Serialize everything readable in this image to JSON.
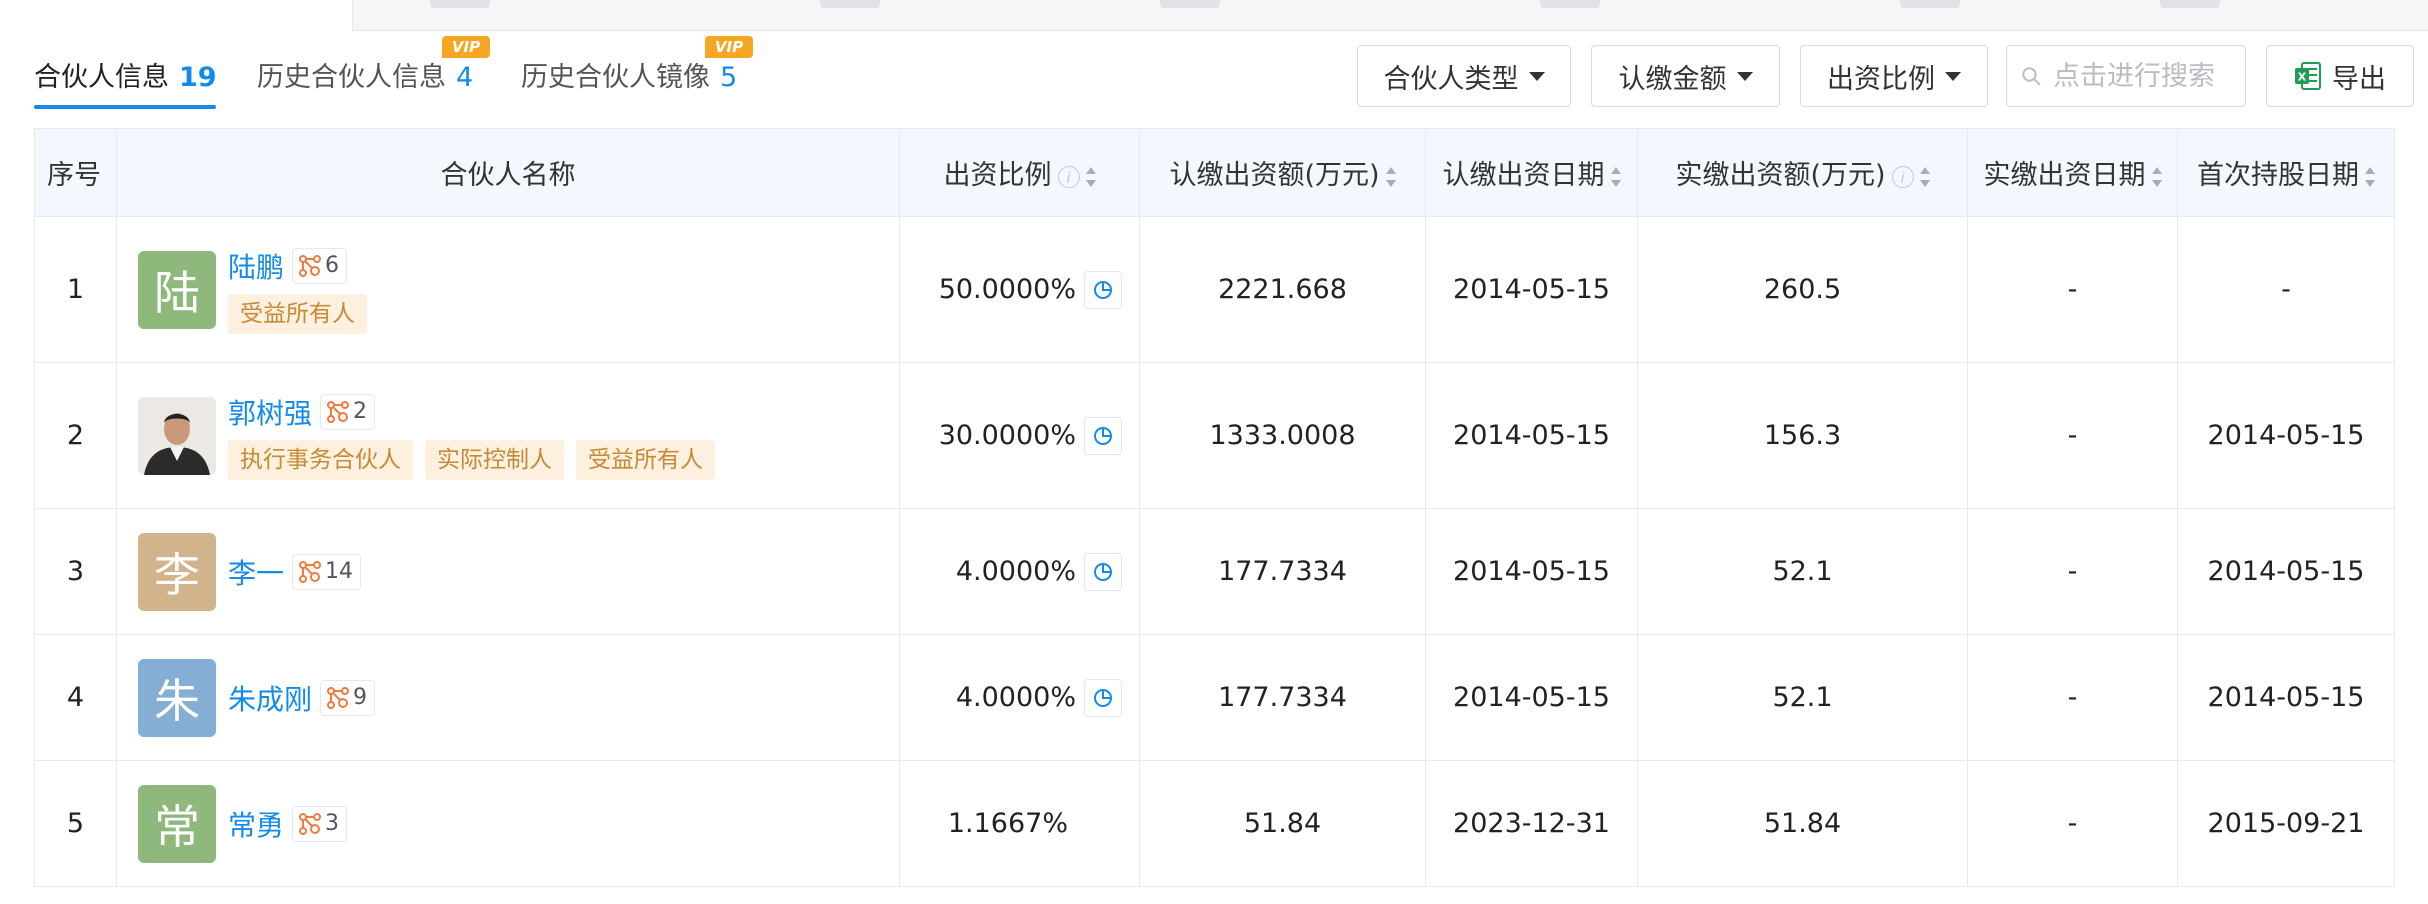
{
  "subtabs": [
    {
      "label": "合伙人信息",
      "count": "19",
      "vip": false
    },
    {
      "label": "历史合伙人信息",
      "count": "4",
      "vip": true
    },
    {
      "label": "历史合伙人镜像",
      "count": "5",
      "vip": true
    }
  ],
  "vip_badge": "VIP",
  "filters": {
    "type": "合伙人类型",
    "amount": "认缴金额",
    "ratio": "出资比例"
  },
  "search": {
    "placeholder": "点击进行搜索"
  },
  "export": {
    "label": "导出"
  },
  "columns": [
    "序号",
    "合伙人名称",
    "出资比例",
    "认缴出资额(万元)",
    "认缴出资日期",
    "实缴出资额(万元)",
    "实缴出资日期",
    "首次持股日期"
  ],
  "rows": [
    {
      "index": "1",
      "avatar_char": "陆",
      "avatar_color": "#8fb87d",
      "name": "陆鹏",
      "rel_count": "6",
      "tags": [
        "受益所有人"
      ],
      "ratio": "50.0000%",
      "sub_amount": "2221.668",
      "sub_date": "2014-05-15",
      "paid_amount": "260.5",
      "paid_date": "-",
      "first_date": "-"
    },
    {
      "index": "2",
      "avatar_char": "",
      "avatar_color": "#e8e8e8",
      "name": "郭树强",
      "rel_count": "2",
      "tags": [
        "执行事务合伙人",
        "实际控制人",
        "受益所有人"
      ],
      "ratio": "30.0000%",
      "sub_amount": "1333.0008",
      "sub_date": "2014-05-15",
      "paid_amount": "156.3",
      "paid_date": "-",
      "first_date": "2014-05-15"
    },
    {
      "index": "3",
      "avatar_char": "李",
      "avatar_color": "#d2b48c",
      "name": "李一",
      "rel_count": "14",
      "tags": [],
      "ratio": "4.0000%",
      "sub_amount": "177.7334",
      "sub_date": "2014-05-15",
      "paid_amount": "52.1",
      "paid_date": "-",
      "first_date": "2014-05-15"
    },
    {
      "index": "4",
      "avatar_char": "朱",
      "avatar_color": "#85aed4",
      "name": "朱成刚",
      "rel_count": "9",
      "tags": [],
      "ratio": "4.0000%",
      "sub_amount": "177.7334",
      "sub_date": "2014-05-15",
      "paid_amount": "52.1",
      "paid_date": "-",
      "first_date": "2014-05-15"
    },
    {
      "index": "5",
      "avatar_char": "常",
      "avatar_color": "#8fb87d",
      "name": "常勇",
      "rel_count": "3",
      "tags": [],
      "ratio": "1.1667%",
      "sub_amount": "51.84",
      "sub_date": "2023-12-31",
      "paid_amount": "51.84",
      "paid_date": "-",
      "first_date": "2015-09-21"
    }
  ],
  "colors": {
    "accent": "#128bed",
    "tag_bg": "#fdf0de",
    "tag_text": "#c78a36",
    "header_bg": "#f2f8fe",
    "relation_icon": "#f07b3f"
  },
  "icons": {
    "search": "search-icon",
    "export": "excel-icon",
    "sort": "sort-icon",
    "info": "info-icon",
    "pie": "pie-chart-icon",
    "relation": "relation-graph-icon"
  }
}
